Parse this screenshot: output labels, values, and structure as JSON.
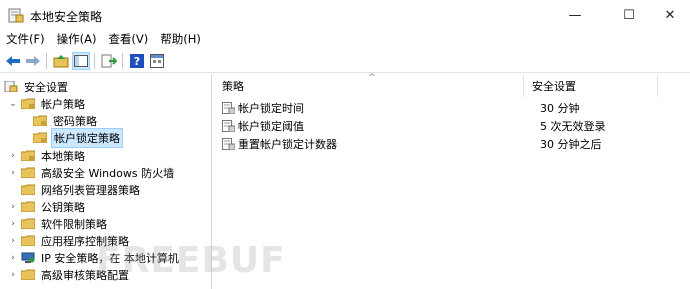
{
  "window": {
    "title": "本地安全策略"
  },
  "menu": [
    {
      "label": "文件(F)"
    },
    {
      "label": "操作(A)"
    },
    {
      "label": "查看(V)"
    },
    {
      "label": "帮助(H)"
    }
  ],
  "toolbar": {
    "icons": [
      "back-arrow-icon",
      "forward-arrow-icon",
      "up-folder-icon",
      "show-hide-tree-icon",
      "export-list-icon",
      "help-icon",
      "properties-icon"
    ]
  },
  "tree": {
    "items": [
      {
        "label": "安全设置"
      },
      {
        "label": "帐户策略"
      },
      {
        "label": "密码策略"
      },
      {
        "label": "帐户锁定策略"
      },
      {
        "label": "本地策略"
      },
      {
        "label": "高级安全 Windows 防火墙"
      },
      {
        "label": "网络列表管理器策略"
      },
      {
        "label": "公钥策略"
      },
      {
        "label": "软件限制策略"
      },
      {
        "label": "应用程序控制策略"
      },
      {
        "label": "IP 安全策略，在 本地计算机"
      },
      {
        "label": "高级审核策略配置"
      }
    ]
  },
  "list": {
    "columns": {
      "policy": "策略",
      "setting": "安全设置"
    },
    "rows": [
      {
        "policy": "帐户锁定时间",
        "setting": "30 分钟"
      },
      {
        "policy": "帐户锁定阈值",
        "setting": "5 次无效登录"
      },
      {
        "policy": "重置帐户锁定计数器",
        "setting": "30 分钟之后"
      }
    ]
  },
  "watermark": "FREEBUF",
  "colors": {
    "selection": "#cce8ff",
    "folder": "#e8c25a",
    "accent": "#1f6fbf"
  }
}
